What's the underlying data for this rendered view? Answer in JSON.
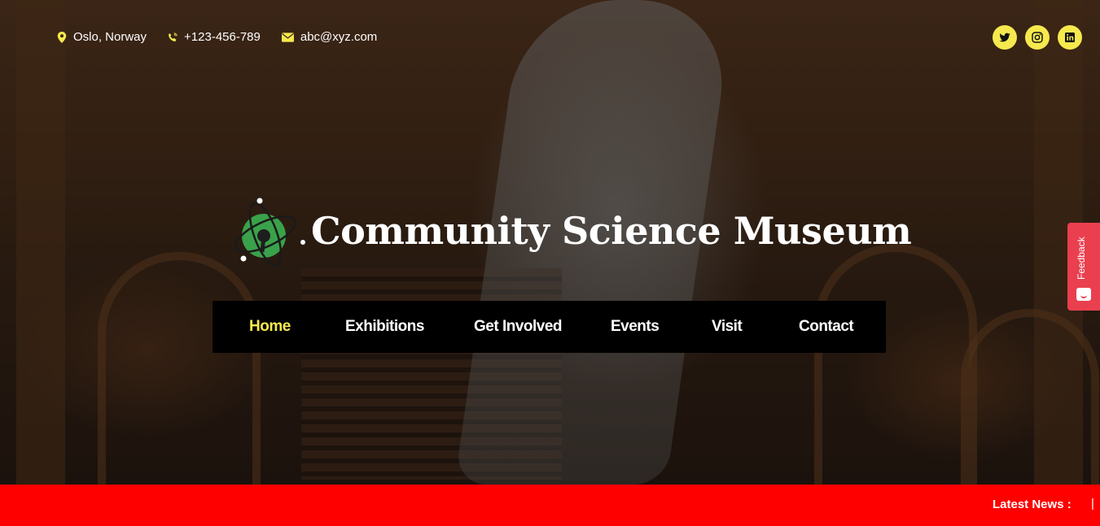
{
  "topbar": {
    "location": "Oslo, Norway",
    "phone": "+123-456-789",
    "email": "abc@xyz.com",
    "icon_color": "#f5e94e"
  },
  "social": [
    {
      "name": "twitter-icon"
    },
    {
      "name": "instagram-icon"
    },
    {
      "name": "linkedin-icon"
    }
  ],
  "brand": {
    "title": "Community Science Museum"
  },
  "nav": {
    "items": [
      "Home",
      "Exhibitions",
      "Get Involved",
      "Events",
      "Visit",
      "Contact"
    ],
    "active": "Home",
    "active_color": "#f5e94e"
  },
  "feedback": {
    "label": "Feedback",
    "color": "#ea3f4f"
  },
  "ticker": {
    "label": "Latest News :",
    "separator": "|",
    "color": "#ff0000"
  }
}
